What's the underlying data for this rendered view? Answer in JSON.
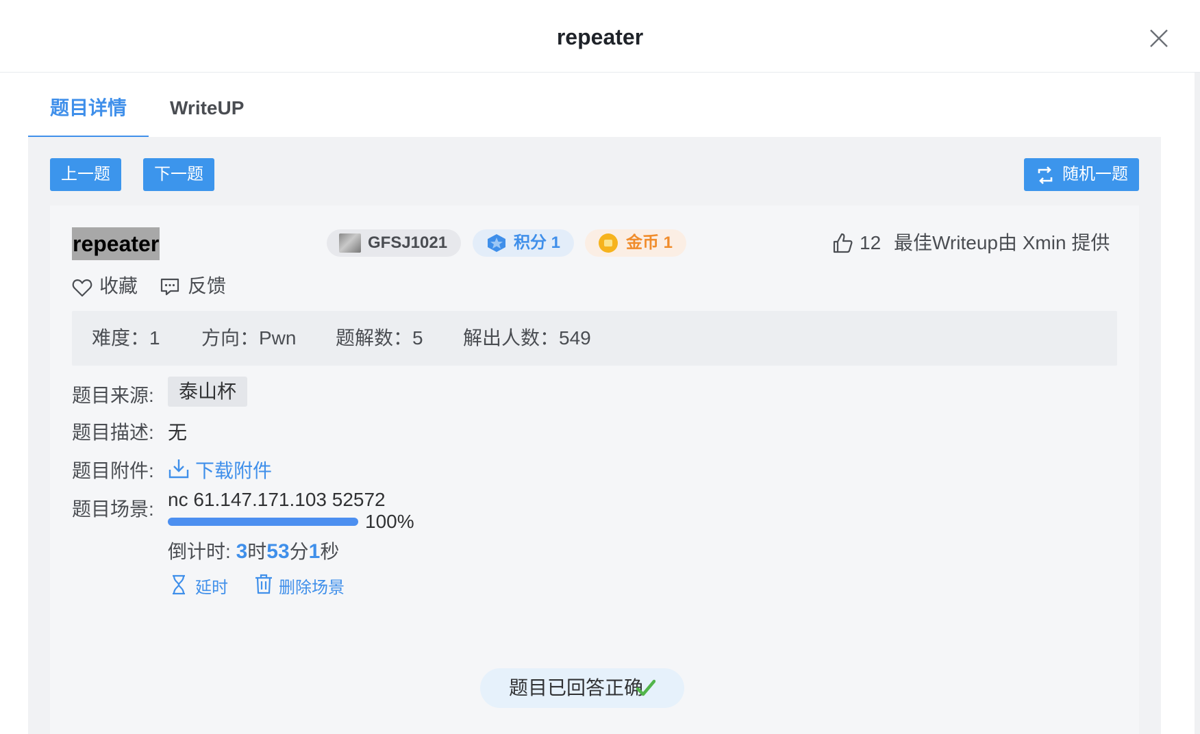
{
  "dialog": {
    "title": "repeater"
  },
  "tabs": [
    {
      "label": "题目详情"
    },
    {
      "label": "WriteUP"
    }
  ],
  "toolbar": {
    "prev_label": "上一题",
    "next_label": "下一题",
    "random_label": "随机一题"
  },
  "challenge": {
    "name": "repeater",
    "id": "GFSJ1021",
    "score": "积分 1",
    "coin": "金币 1",
    "likes": "12",
    "best_writeup": "最佳Writeup由 Xmin 提供",
    "favorite_label": "收藏",
    "feedback_label": "反馈",
    "stats": {
      "difficulty": "难度：1",
      "direction": "方向：Pwn",
      "writeups": "题解数：5",
      "solvers": "解出人数：549"
    },
    "source_label": "题目来源:",
    "source": "泰山杯",
    "desc_label": "题目描述:",
    "desc": "无",
    "attach_label": "题目附件:",
    "attach_link": "下载附件",
    "scene_label": "题目场景:",
    "scene_address": "nc 61.147.171.103 52572",
    "scene_progress": 1.0,
    "scene_progress_text": "100%",
    "countdown_prefix": "倒计时:",
    "countdown_h": "3",
    "countdown_h_unit": "时",
    "countdown_m": "53",
    "countdown_m_unit": "分",
    "countdown_s": "1",
    "countdown_s_unit": "秒",
    "extend_label": "延时",
    "delete_label": "删除场景",
    "answered": "题目已回答正确"
  },
  "colors": {
    "accent": "#3f8fea",
    "button": "#3c95ec",
    "success": "#52b54b",
    "coin": "#f08c2b"
  }
}
